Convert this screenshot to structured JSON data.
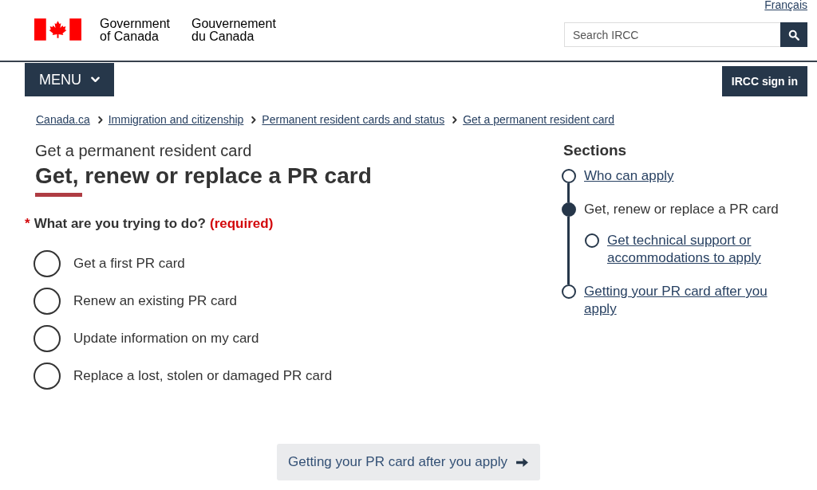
{
  "header": {
    "language_link": "Français",
    "signature_en": "Government of Canada",
    "signature_fr": "Gouvernement du Canada",
    "search": {
      "placeholder": "Search IRCC"
    }
  },
  "nav": {
    "menu_button": "MENU",
    "sign_in_button": "IRCC sign in"
  },
  "breadcrumbs": [
    "Canada.ca",
    "Immigration and citizenship",
    "Permanent resident cards and status",
    "Get a permanent resident card"
  ],
  "page": {
    "kicker": "Get a permanent resident card",
    "title": "Get, renew or replace a PR card"
  },
  "question": {
    "required_marker": "*",
    "label": "What are you trying to do?",
    "required_note": "(required)"
  },
  "options": [
    {
      "label": "Get a first PR card",
      "selected": false
    },
    {
      "label": "Renew an existing PR card",
      "selected": false
    },
    {
      "label": "Update information on my card",
      "selected": false
    },
    {
      "label": "Replace a lost, stolen or damaged PR card",
      "selected": false
    }
  ],
  "sections": {
    "heading": "Sections",
    "items": [
      {
        "label": "Who can apply",
        "current": false
      },
      {
        "label": "Get, renew or replace a PR card",
        "current": true,
        "children": [
          {
            "label": "Get technical support or accommodations to apply",
            "current": false
          }
        ]
      },
      {
        "label": "Getting your PR card after you apply",
        "current": false
      }
    ]
  },
  "next_button": {
    "label": "Getting your PR card after you apply"
  }
}
